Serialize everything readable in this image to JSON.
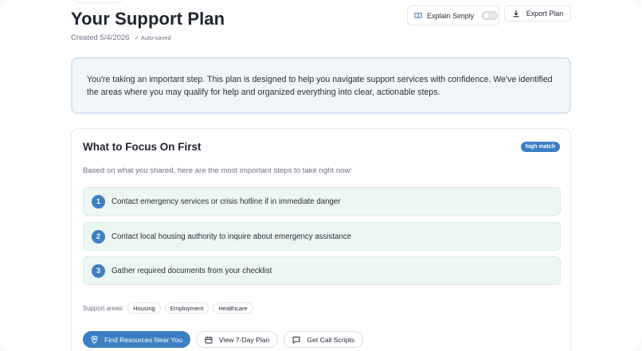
{
  "header": {
    "title": "Your Support Plan",
    "created": "Created 5/4/2026",
    "autosave": "Auto-saved",
    "explain_label": "Explain Simply",
    "explain_enabled": false,
    "export_label": "Export Plan"
  },
  "intro": {
    "text": "You're taking an important step. This plan is designed to help you navigate support services with confidence. We've identified the areas where you may qualify for help and organized everything into clear, actionable steps."
  },
  "focus": {
    "title": "What to Focus On First",
    "badge": "high match",
    "subtitle": "Based on what you shared, here are the most important steps to take right now:",
    "steps": [
      {
        "num": "1",
        "text": "Contact emergency services or crisis hotline if in immediate danger"
      },
      {
        "num": "2",
        "text": "Contact local housing authority to inquire about emergency assistance"
      },
      {
        "num": "3",
        "text": "Gather required documents from your checklist"
      }
    ],
    "areas_label": "Support areas:",
    "areas": [
      "Housing",
      "Employment",
      "Healthcare"
    ],
    "actions": {
      "find": "Find Resources Near You",
      "plan": "View 7-Day Plan",
      "scripts": "Get Call Scripts"
    }
  },
  "colors": {
    "accent": "#3d7fc3",
    "step_bg": "#ecf6f3",
    "intro_bg": "#f1f6fb"
  }
}
